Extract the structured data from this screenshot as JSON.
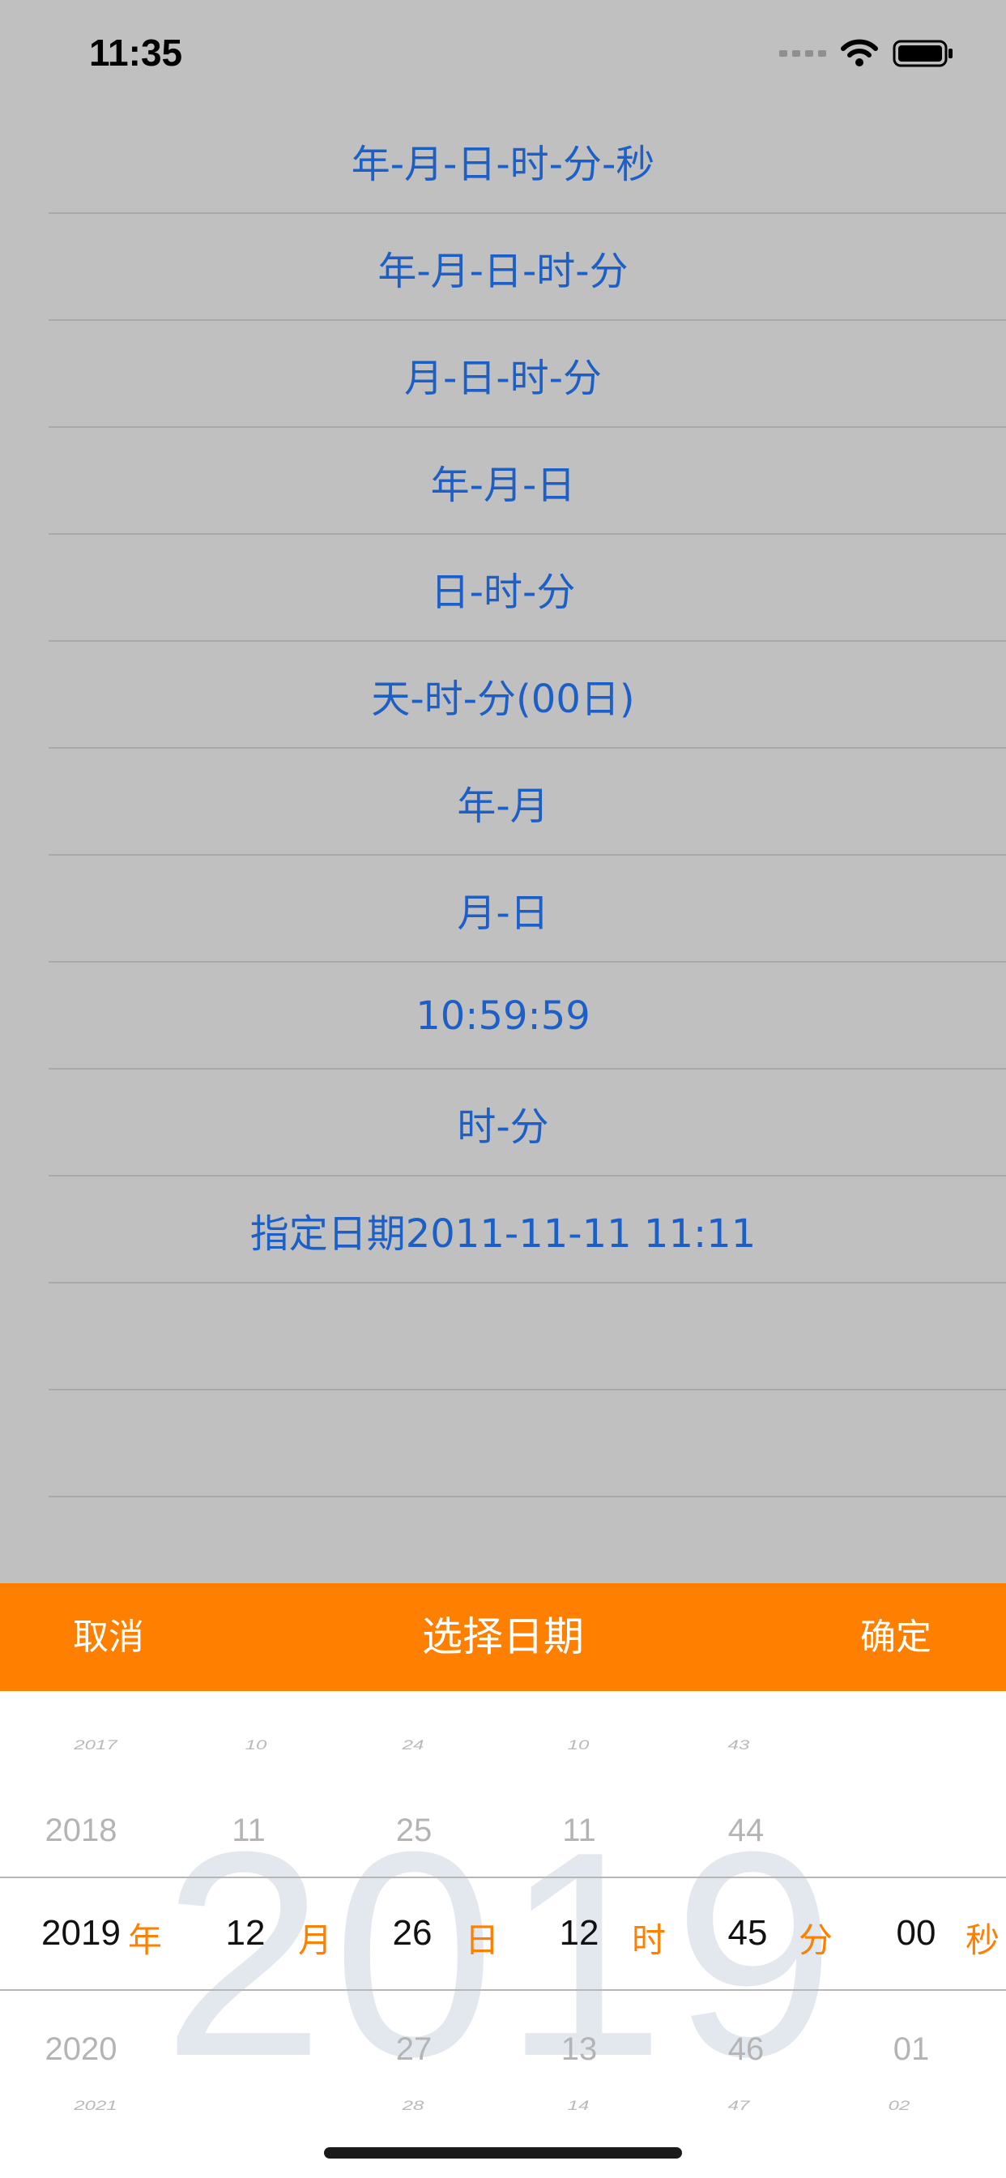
{
  "status_bar": {
    "time": "11:35"
  },
  "list": {
    "items": [
      "年-月-日-时-分-秒",
      "年-月-日-时-分",
      "月-日-时-分",
      "年-月-日",
      "日-时-分",
      "天-时-分(00日)",
      "年-月",
      "月-日",
      "10:59:59",
      "时-分",
      "指定日期2011-11-11 11:11",
      "",
      ""
    ]
  },
  "picker_header": {
    "cancel": "取消",
    "title": "选择日期",
    "confirm": "确定"
  },
  "picker": {
    "watermark": "2019",
    "year": {
      "values": [
        "2017",
        "2018",
        "2019",
        "2020",
        "2021"
      ],
      "unit": "年"
    },
    "month": {
      "values": [
        "10",
        "11",
        "12"
      ],
      "unit": "月"
    },
    "day": {
      "values": [
        "24",
        "25",
        "26",
        "27",
        "28"
      ],
      "unit": "日"
    },
    "hour": {
      "values": [
        "10",
        "11",
        "12",
        "13",
        "14"
      ],
      "unit": "时"
    },
    "minute": {
      "values": [
        "43",
        "44",
        "45",
        "46",
        "47"
      ],
      "unit": "分"
    },
    "second": {
      "values": [
        "00",
        "01",
        "02"
      ],
      "unit": "秒"
    }
  },
  "colors": {
    "accent": "#ff7f00",
    "link": "#1c5fc7",
    "backdrop": "#c0c0c0"
  }
}
